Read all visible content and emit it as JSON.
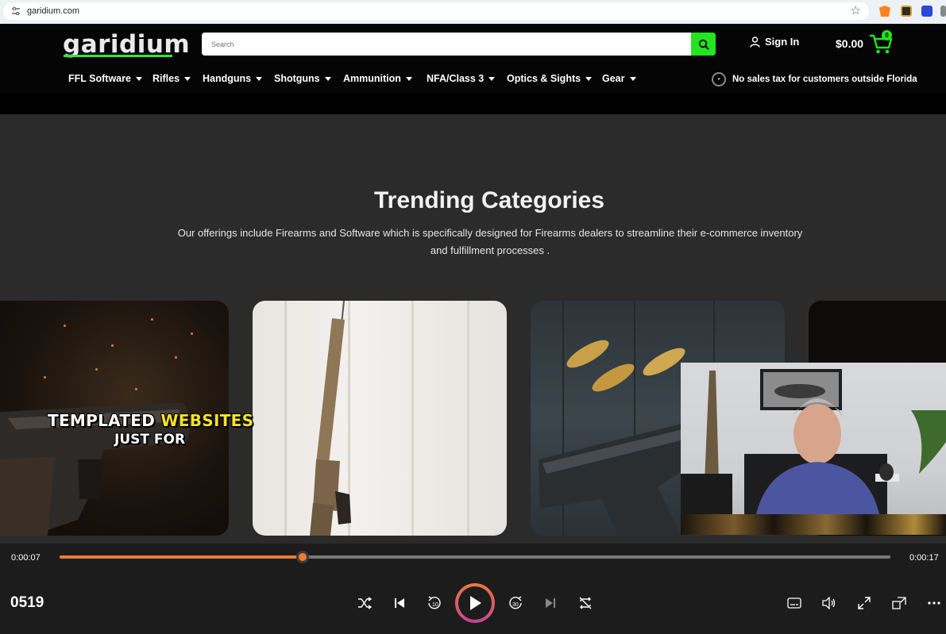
{
  "browser": {
    "url": "garidium.com",
    "icons": [
      "site-info-icon",
      "bookmark-star-icon",
      "metamask-extension-icon",
      "extension-icon",
      "extension-icon",
      "extension-icon"
    ]
  },
  "header": {
    "logo": "garidium",
    "search_placeholder": "Search",
    "sign_in": "Sign In",
    "cart_total": "$0.00",
    "cart_count": "0",
    "accent_color": "#22e41f"
  },
  "nav": {
    "items": [
      {
        "label": "FFL Software"
      },
      {
        "label": "Rifles"
      },
      {
        "label": "Handguns"
      },
      {
        "label": "Shotguns"
      },
      {
        "label": "Ammunition"
      },
      {
        "label": "NFA/Class 3"
      },
      {
        "label": "Optics & Sights"
      },
      {
        "label": "Gear"
      }
    ],
    "tax_note": "No sales tax for customers outside Florida"
  },
  "main": {
    "title": "Trending Categories",
    "description_line1": "Our offerings include Firearms and Software which is specifically designed for Firearms dealers to streamline their e-commerce inventory",
    "description_line2": "and fulfillment processes ."
  },
  "caption": {
    "line1_a": "TEMPLATED",
    "line1_b": "WEBSITES",
    "line2": "JUST FOR",
    "highlight_color": "#f6e227"
  },
  "player": {
    "current_time": "0:00:07",
    "end_time": "0:00:17",
    "progress": 0.293,
    "title": "0519",
    "accent_color": "#f07b34",
    "controls": [
      "shuffle-icon",
      "previous-icon",
      "rewind-10-icon",
      "play-icon",
      "forward-30-icon",
      "next-icon",
      "repeat-off-icon",
      "subtitles-icon",
      "volume-icon",
      "fullscreen-icon",
      "mini-player-icon",
      "more-icon"
    ]
  }
}
